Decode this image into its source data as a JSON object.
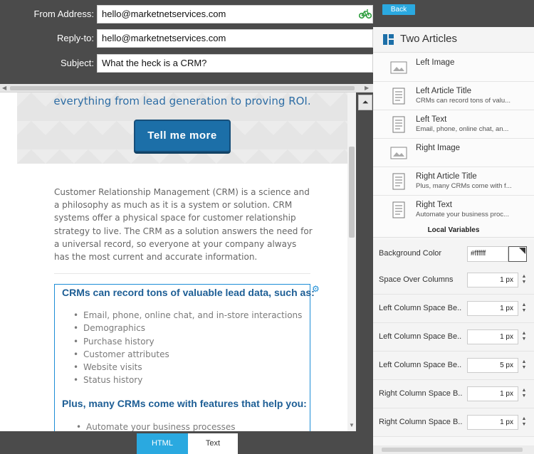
{
  "header": {
    "from_label": "From Address:",
    "from_value": "hello@marketnetservices.com",
    "replyto_label": "Reply-to:",
    "replyto_value": "hello@marketnetservices.com",
    "subject_label": "Subject:",
    "subject_value": "What the heck is a CRM?",
    "from_icon": "bike-icon"
  },
  "preview": {
    "hero_text": "everything from lead generation to proving ROI.",
    "hero_button": "Tell me more",
    "intro": "Customer Relationship Management (CRM) is a science and a philosophy as much as it is a system or solution. CRM systems offer a physical space for customer relationship strategy to live. The CRM as a solution answers the need for a universal record, so everyone at your company always has the most current and accurate information.",
    "box_heading_1": "CRMs can record tons of valuable lead data, such as:",
    "list_1": [
      "Email, phone, online chat, and in-store interactions",
      "Demographics",
      "Purchase history",
      "Customer attributes",
      "Website visits",
      "Status history"
    ],
    "box_heading_2": "Plus, many CRMs come with features that help you:",
    "list_2": [
      "Automate your business processes"
    ]
  },
  "tabs": {
    "html": "HTML",
    "text": "Text"
  },
  "right_panel": {
    "back_label": "Back",
    "section_title": "Two Articles",
    "items": [
      {
        "name": "Left Image",
        "sub": "",
        "icon": "image-icon"
      },
      {
        "name": "Left Article Title",
        "sub": "CRMs can record tons of valu...",
        "icon": "text-doc-icon"
      },
      {
        "name": "Left Text",
        "sub": "Email, phone, online chat, an...",
        "icon": "text-doc-icon"
      },
      {
        "name": "Right Image",
        "sub": "",
        "icon": "image-icon"
      },
      {
        "name": "Right Article Title",
        "sub": "Plus, many CRMs come with f...",
        "icon": "text-doc-icon"
      },
      {
        "name": "Right Text",
        "sub": "Automate your business proc...",
        "icon": "text-doc-icon"
      }
    ],
    "local_vars_heading": "Local Variables",
    "bg_color_label": "Background Color",
    "bg_color_value": "#ffffff",
    "variables": [
      {
        "label": "Space Over Columns",
        "value": "1 px"
      },
      {
        "label": "Left Column Space Be..",
        "value": "1 px"
      },
      {
        "label": "Left Column Space Be..",
        "value": "1 px"
      },
      {
        "label": "Left Column Space Be..",
        "value": "5 px"
      },
      {
        "label": "Right Column Space B..",
        "value": "1 px"
      },
      {
        "label": "Right Column Space B..",
        "value": "1 px"
      }
    ]
  },
  "colors": {
    "accent": "#2aa9e0",
    "dark_bg": "#4b4b4b",
    "heading_blue": "#1d5e95"
  }
}
